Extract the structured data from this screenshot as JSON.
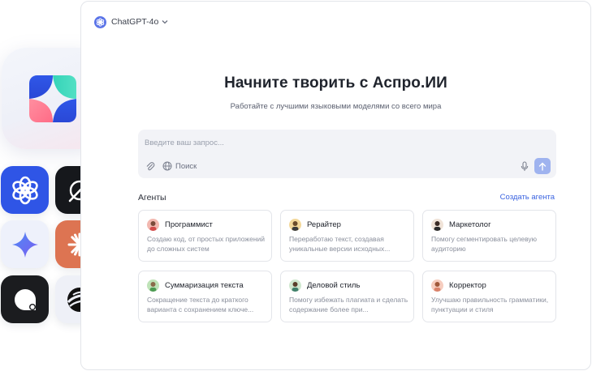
{
  "header": {
    "model_name": "ChatGPT-4o",
    "model_icon": "openai-icon"
  },
  "hero": {
    "title": "Начните творить с Аспро.ИИ",
    "subtitle": "Работайте с лучшими языковыми моделями со всего мира"
  },
  "prompt": {
    "placeholder": "Введите ваш запрос...",
    "value": "",
    "search_label": "Поиск"
  },
  "agents": {
    "title": "Агенты",
    "create_label": "Создать агента",
    "items": [
      {
        "title": "Программист",
        "description": "Создаю код, от простых приложений до сложных систем",
        "avatar_color": "#f2b8b0"
      },
      {
        "title": "Рерайтер",
        "description": "Переработаю текст, создавая уникальные версии исходных...",
        "avatar_color": "#f3d89a"
      },
      {
        "title": "Маркетолог",
        "description": "Помогу сегментировать целевую аудиторию",
        "avatar_color": "#f0e3d8"
      },
      {
        "title": "Суммаризация текста",
        "description": "Сокращение текста до краткого варианта с сохранением ключе...",
        "avatar_color": "#bfe3b8"
      },
      {
        "title": "Деловой стиль",
        "description": "Помогу избежать плагиата и сделать содержание более при...",
        "avatar_color": "#cfe8cf"
      },
      {
        "title": "Корректор",
        "description": "Улучшаю правильность грамматики, пунктуации и стиля",
        "avatar_color": "#f6cdbf"
      }
    ]
  },
  "side_apps": [
    "aspro-ai-icon",
    "openai-icon",
    "grok-icon",
    "gemini-icon",
    "claude-icon",
    "black-dot-app-icon",
    "yandex-gpt-icon"
  ],
  "colors": {
    "accent": "#3a63e0",
    "send_button": "#9fb3ef",
    "prompt_bg": "#f2f3f7"
  }
}
